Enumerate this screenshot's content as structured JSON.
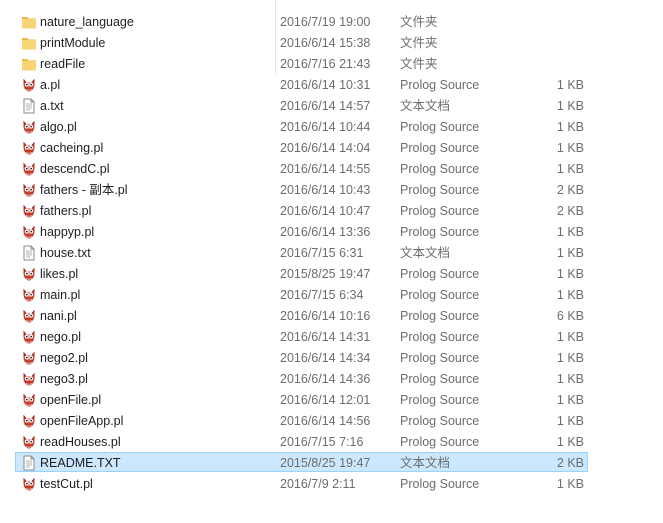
{
  "files": [
    {
      "name": "nature_language",
      "date": "2016/7/19 19:00",
      "type": "文件夹",
      "size": "",
      "icon": "folder-icon"
    },
    {
      "name": "printModule",
      "date": "2016/6/14 15:38",
      "type": "文件夹",
      "size": "",
      "icon": "folder-icon"
    },
    {
      "name": "readFile",
      "date": "2016/7/16 21:43",
      "type": "文件夹",
      "size": "",
      "icon": "folder-icon"
    },
    {
      "name": "a.pl",
      "date": "2016/6/14 10:31",
      "type": "Prolog Source",
      "size": "1 KB",
      "icon": "prolog-owl-icon"
    },
    {
      "name": "a.txt",
      "date": "2016/6/14 14:57",
      "type": "文本文档",
      "size": "1 KB",
      "icon": "text-file-icon"
    },
    {
      "name": "algo.pl",
      "date": "2016/6/14 10:44",
      "type": "Prolog Source",
      "size": "1 KB",
      "icon": "prolog-owl-icon"
    },
    {
      "name": "cacheing.pl",
      "date": "2016/6/14 14:04",
      "type": "Prolog Source",
      "size": "1 KB",
      "icon": "prolog-owl-icon"
    },
    {
      "name": "descendC.pl",
      "date": "2016/6/14 14:55",
      "type": "Prolog Source",
      "size": "1 KB",
      "icon": "prolog-owl-icon"
    },
    {
      "name": "fathers - 副本.pl",
      "date": "2016/6/14 10:43",
      "type": "Prolog Source",
      "size": "2 KB",
      "icon": "prolog-owl-icon"
    },
    {
      "name": "fathers.pl",
      "date": "2016/6/14 10:47",
      "type": "Prolog Source",
      "size": "2 KB",
      "icon": "prolog-owl-icon"
    },
    {
      "name": "happyp.pl",
      "date": "2016/6/14 13:36",
      "type": "Prolog Source",
      "size": "1 KB",
      "icon": "prolog-owl-icon"
    },
    {
      "name": "house.txt",
      "date": "2016/7/15 6:31",
      "type": "文本文档",
      "size": "1 KB",
      "icon": "text-file-icon"
    },
    {
      "name": "likes.pl",
      "date": "2015/8/25 19:47",
      "type": "Prolog Source",
      "size": "1 KB",
      "icon": "prolog-owl-icon"
    },
    {
      "name": "main.pl",
      "date": "2016/7/15 6:34",
      "type": "Prolog Source",
      "size": "1 KB",
      "icon": "prolog-owl-icon"
    },
    {
      "name": "nani.pl",
      "date": "2016/6/14 10:16",
      "type": "Prolog Source",
      "size": "6 KB",
      "icon": "prolog-owl-icon"
    },
    {
      "name": "nego.pl",
      "date": "2016/6/14 14:31",
      "type": "Prolog Source",
      "size": "1 KB",
      "icon": "prolog-owl-icon"
    },
    {
      "name": "nego2.pl",
      "date": "2016/6/14 14:34",
      "type": "Prolog Source",
      "size": "1 KB",
      "icon": "prolog-owl-icon"
    },
    {
      "name": "nego3.pl",
      "date": "2016/6/14 14:36",
      "type": "Prolog Source",
      "size": "1 KB",
      "icon": "prolog-owl-icon"
    },
    {
      "name": "openFile.pl",
      "date": "2016/6/14 12:01",
      "type": "Prolog Source",
      "size": "1 KB",
      "icon": "prolog-owl-icon"
    },
    {
      "name": "openFileApp.pl",
      "date": "2016/6/14 14:56",
      "type": "Prolog Source",
      "size": "1 KB",
      "icon": "prolog-owl-icon"
    },
    {
      "name": "readHouses.pl",
      "date": "2016/7/15 7:16",
      "type": "Prolog Source",
      "size": "1 KB",
      "icon": "prolog-owl-icon"
    },
    {
      "name": "README.TXT",
      "date": "2015/8/25 19:47",
      "type": "文本文档",
      "size": "2 KB",
      "icon": "text-file-icon",
      "selected": true
    },
    {
      "name": "testCut.pl",
      "date": "2016/7/9 2:11",
      "type": "Prolog Source",
      "size": "1 KB",
      "icon": "prolog-owl-icon"
    }
  ],
  "colors": {
    "folder": "#f8d574",
    "folder_tab": "#e8b84a",
    "owl_body": "#c0392b",
    "owl_ear": "#8e2418",
    "selection_bg": "#cce8ff",
    "selection_border": "#99d1ff"
  }
}
